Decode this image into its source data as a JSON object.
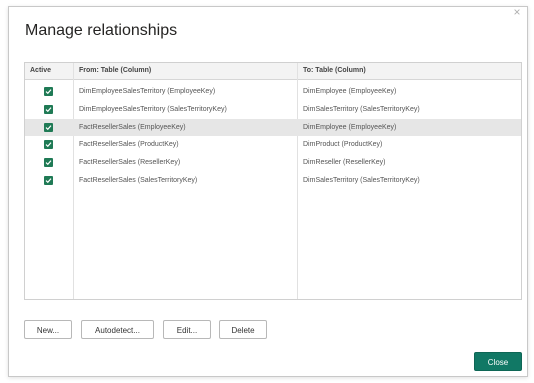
{
  "dialog": {
    "title": "Manage relationships",
    "close_glyph": "×"
  },
  "table": {
    "headers": {
      "active": "Active",
      "from": "From: Table (Column)",
      "to": "To: Table (Column)"
    },
    "rows": [
      {
        "active": true,
        "from": "DimEmployeeSalesTerritory (EmployeeKey)",
        "to": "DimEmployee (EmployeeKey)"
      },
      {
        "active": true,
        "from": "DimEmployeeSalesTerritory (SalesTerritoryKey)",
        "to": "DimSalesTerritory (SalesTerritoryKey)"
      },
      {
        "active": true,
        "from": "FactResellerSales (EmployeeKey)",
        "to": "DimEmployee (EmployeeKey)"
      },
      {
        "active": true,
        "from": "FactResellerSales (ProductKey)",
        "to": "DimProduct (ProductKey)"
      },
      {
        "active": true,
        "from": "FactResellerSales (ResellerKey)",
        "to": "DimReseller (ResellerKey)"
      },
      {
        "active": true,
        "from": "FactResellerSales (SalesTerritoryKey)",
        "to": "DimSalesTerritory (SalesTerritoryKey)"
      }
    ],
    "selected_row": 2
  },
  "buttons": {
    "new": "New...",
    "autodetect": "Autodetect...",
    "edit": "Edit...",
    "delete": "Delete",
    "close": "Close"
  },
  "colors": {
    "accent": "#117865",
    "checkbox": "#1f7a55",
    "selected_row": "#e6e6e6"
  }
}
